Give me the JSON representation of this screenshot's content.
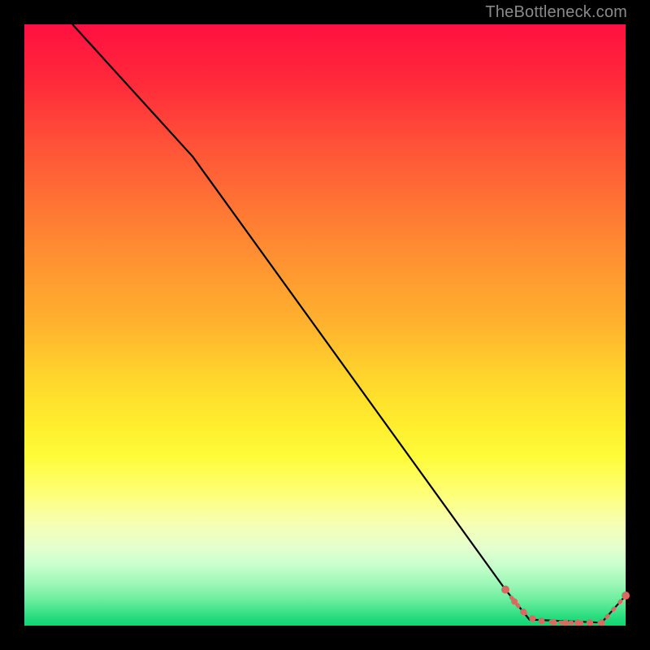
{
  "watermark": "TheBottleneck.com",
  "colors": {
    "line": "#000000",
    "marker": "#d86a62"
  },
  "chart_data": {
    "type": "line",
    "title": "",
    "xlabel": "",
    "ylabel": "",
    "xlim": [
      0,
      100
    ],
    "ylim": [
      0,
      100
    ],
    "grid": false,
    "series": [
      {
        "name": "curve",
        "x": [
          8,
          28,
          80,
          84,
          96,
          100
        ],
        "y": [
          100,
          78,
          6,
          1,
          0.5,
          5
        ]
      }
    ],
    "markers": {
      "name": "highlight-segment",
      "points": [
        {
          "x": 80.0,
          "y": 6.0
        },
        {
          "x": 81.5,
          "y": 4.0
        },
        {
          "x": 83.0,
          "y": 2.3
        },
        {
          "x": 84.5,
          "y": 1.2
        },
        {
          "x": 86.0,
          "y": 0.8
        },
        {
          "x": 88.0,
          "y": 0.6
        },
        {
          "x": 90.0,
          "y": 0.5
        },
        {
          "x": 92.0,
          "y": 0.5
        },
        {
          "x": 94.0,
          "y": 0.5
        },
        {
          "x": 96.0,
          "y": 0.5
        },
        {
          "x": 100.0,
          "y": 5.0
        }
      ]
    }
  }
}
